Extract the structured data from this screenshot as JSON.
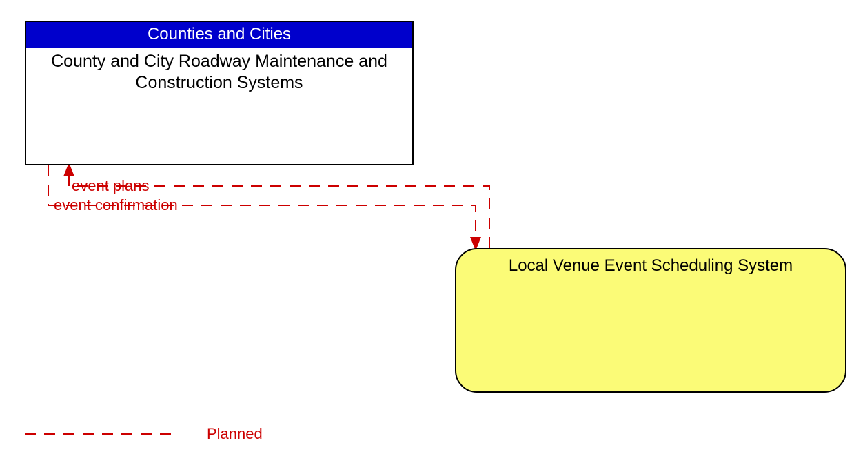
{
  "entities": {
    "top": {
      "header": "Counties and Cities",
      "body": "County and City Roadway Maintenance and Construction Systems"
    },
    "bottom": {
      "label": "Local Venue Event Scheduling System"
    }
  },
  "flows": {
    "toTop": "event plans",
    "toBottom": "event confirmation"
  },
  "legend": {
    "planned": "Planned"
  },
  "colors": {
    "headerBg": "#0000cc",
    "headerText": "#ffffff",
    "venueBg": "#fbfb77",
    "flowLine": "#cc0000"
  }
}
